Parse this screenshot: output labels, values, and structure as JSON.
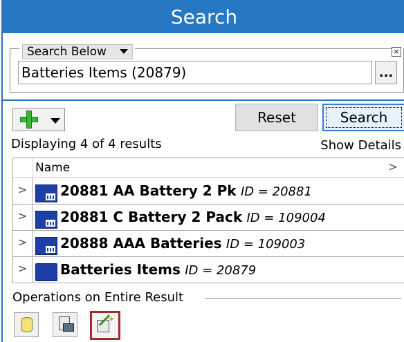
{
  "header": {
    "title": "Search"
  },
  "criteria": {
    "scope_label": "Search Below",
    "value": "Batteries Items (20879)",
    "ellipsis_label": "...",
    "close_label": "×"
  },
  "toolbar": {
    "add_icon": "green-plus-icon",
    "reset_label": "Reset",
    "search_label": "Search"
  },
  "results": {
    "count_text": "Displaying 4 of 4 results",
    "show_details_label": "Show Details",
    "column_header": "Name",
    "items": [
      {
        "name": "20881 AA Battery 2 Pk",
        "id_text": "ID = 20881",
        "icon": "item-revision-icon"
      },
      {
        "name": "20881 C Battery 2 Pack",
        "id_text": "ID = 109004",
        "icon": "item-revision-icon"
      },
      {
        "name": "20888 AAA Batteries",
        "id_text": "ID = 109003",
        "icon": "item-revision-icon"
      },
      {
        "name": "Batteries Items",
        "id_text": "ID = 20879",
        "icon": "folder-icon"
      }
    ]
  },
  "operations": {
    "legend": "Operations on Entire Result",
    "buttons": [
      {
        "icon": "database-icon"
      },
      {
        "icon": "export-icon"
      },
      {
        "icon": "wizard-icon",
        "selected": true
      }
    ]
  },
  "colors": {
    "title_bar": "#2677c4",
    "accent": "#3a7bd5",
    "item_icon": "#1f3fa8",
    "selected_border": "#a32b2b"
  }
}
